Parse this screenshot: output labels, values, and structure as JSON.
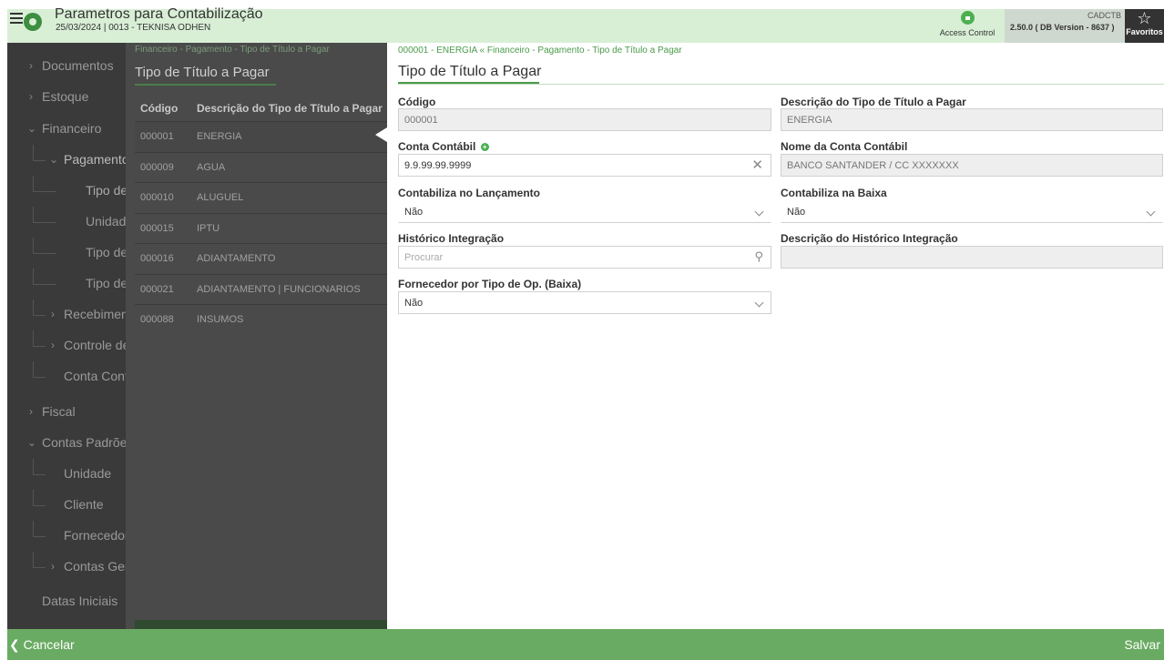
{
  "header": {
    "title": "Parametros para Contabilização",
    "subtitle": "25/03/2024 | 0013 - TEKNISA ODHEN",
    "access_control": "Access Control",
    "program_code": "CADCTB",
    "version": "2.50.0 ( DB Version - 8637 )",
    "favorites": "Favoritos"
  },
  "sidebar": {
    "items": [
      {
        "label": "Documentos"
      },
      {
        "label": "Estoque"
      },
      {
        "label": "Financeiro"
      },
      {
        "label": "Pagamento"
      },
      {
        "label": "Tipo de Título a Pagar"
      },
      {
        "label": "Unidade"
      },
      {
        "label": "Tipo de"
      },
      {
        "label": "Tipo de"
      },
      {
        "label": "Recebimento"
      },
      {
        "label": "Controle de"
      },
      {
        "label": "Conta Contábil"
      },
      {
        "label": "Fiscal"
      },
      {
        "label": "Contas Padrões"
      },
      {
        "label": "Unidade"
      },
      {
        "label": "Cliente"
      },
      {
        "label": "Fornecedor"
      },
      {
        "label": "Contas Gerais"
      },
      {
        "label": "Datas Iniciais"
      }
    ]
  },
  "list": {
    "breadcrumb": "Financeiro - Pagamento - Tipo de Título a Pagar",
    "title": "Tipo de Título a Pagar",
    "columns": [
      "Código",
      "Descrição do Tipo de Título a Pagar"
    ],
    "rows": [
      {
        "code": "000001",
        "desc": "ENERGIA"
      },
      {
        "code": "000009",
        "desc": "AGUA"
      },
      {
        "code": "000010",
        "desc": "ALUGUEL"
      },
      {
        "code": "000015",
        "desc": "IPTU"
      },
      {
        "code": "000016",
        "desc": "ADIANTAMENTO"
      },
      {
        "code": "000021",
        "desc": "ADIANTAMENTO | FUNCIONARIOS"
      },
      {
        "code": "000088",
        "desc": "INSUMOS"
      }
    ]
  },
  "form": {
    "breadcrumb": "000001 - ENERGIA « Financeiro - Pagamento - Tipo de Título a Pagar",
    "title": "Tipo de Título a Pagar",
    "codigo_label": "Código",
    "codigo_value": "000001",
    "descricao_label": "Descrição do Tipo de Título a Pagar",
    "descricao_value": "ENERGIA",
    "conta_label": "Conta Contábil",
    "conta_value": "9.9.99.99.9999",
    "nome_conta_label": "Nome da Conta Contábil",
    "nome_conta_value": "BANCO SANTANDER / CC XXXXXXX",
    "contabiliza_lanc_label": "Contabiliza no Lançamento",
    "contabiliza_lanc_value": "Não",
    "contabiliza_baixa_label": "Contabiliza na Baixa",
    "contabiliza_baixa_value": "Não",
    "historico_label": "Histórico Integração",
    "historico_placeholder": "Procurar",
    "desc_historico_label": "Descrição do Histórico Integração",
    "desc_historico_value": "",
    "fornecedor_label": "Fornecedor por Tipo de Op. (Baixa)",
    "fornecedor_value": "Não"
  },
  "footer": {
    "cancel": "❮ Cancelar",
    "save": "Salvar"
  },
  "colors": {
    "header_bg": "#d8efd6",
    "accent_green": "#4b9a4b",
    "footer_green": "#6aab63",
    "sidebar_bg": "#3a3a3a"
  }
}
